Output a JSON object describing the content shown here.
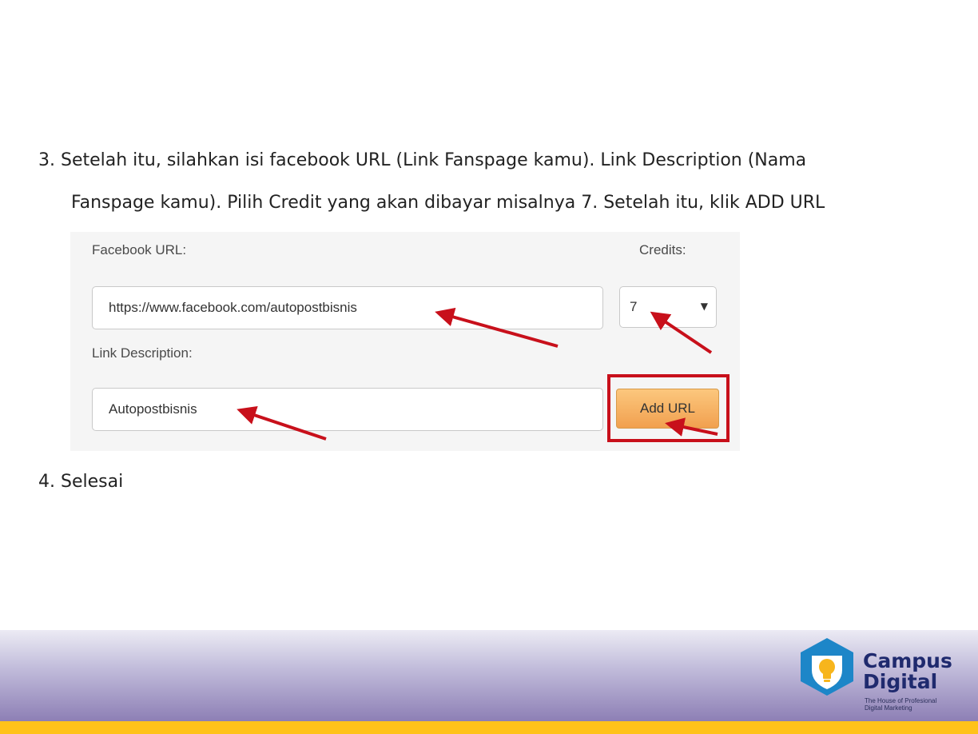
{
  "instructions": {
    "step3_line1": "3. Setelah itu, silahkan isi facebook URL (Link Fanspage kamu). Link Description (Nama",
    "step3_line2": "Fanspage kamu). Pilih Credit yang akan dibayar misalnya 7. Setelah itu, klik ADD  URL",
    "step4": "4.  Selesai"
  },
  "form": {
    "facebook_url_label": "Facebook URL:",
    "facebook_url_value": "https://www.facebook.com/autopostbisnis",
    "credits_label": "Credits:",
    "credits_value": "7",
    "link_description_label": "Link Description:",
    "link_description_value": "Autopostbisnis",
    "add_url_button": "Add URL"
  },
  "footer": {
    "brand_line1": "Campus",
    "brand_line2": "Digital",
    "tagline_line1": "The House of Profesional",
    "tagline_line2": "Digital Marketing"
  },
  "colors": {
    "highlight": "#c8101b",
    "arrow": "#c8101b",
    "button_top": "#fcc77d",
    "button_bottom": "#f1a04f",
    "footer_stripe": "#ffc21a",
    "footer_gradient_end": "#8d7fb5",
    "brand_text": "#1f2a6e",
    "logo_shield": "#1d86c8"
  },
  "icons": {
    "select_caret": "caret-down-icon",
    "logo": "lightbulb-shield-icon"
  }
}
